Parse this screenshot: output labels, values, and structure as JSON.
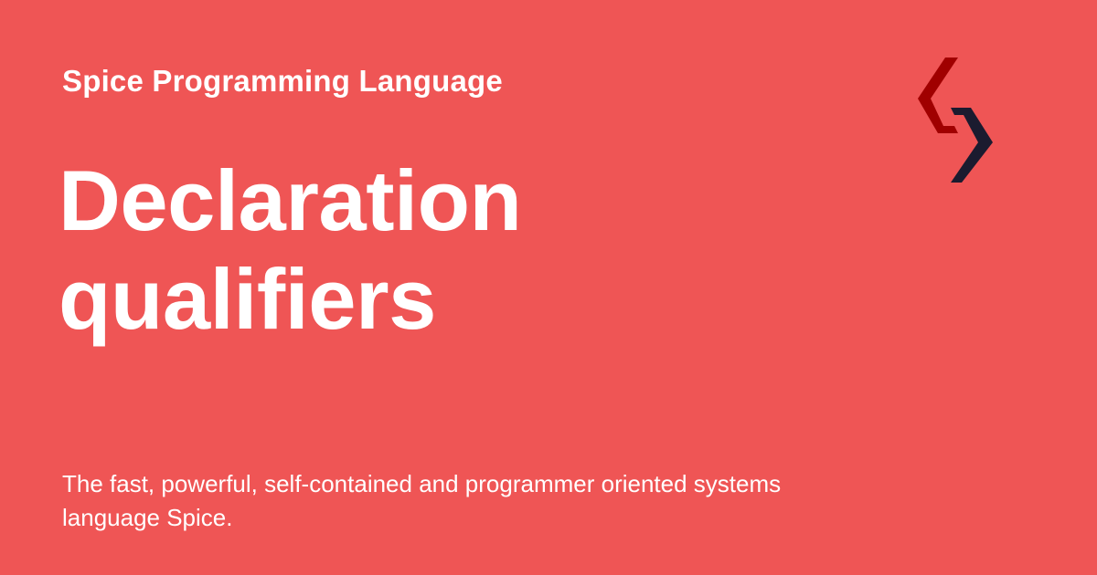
{
  "card": {
    "background_color": "#EF5555",
    "text_color": "#FFFFFF",
    "site_name": "Spice Programming Language",
    "title_line_1": "Declaration",
    "title_line_2": "qualifiers",
    "description": "The fast, powerful, self-contained and programmer oriented systems language Spice.",
    "logo": {
      "icon": "spice-logo-icon",
      "colors": {
        "left_chevron": "#A00000",
        "right_chevron": "#1B1B2F"
      }
    }
  }
}
